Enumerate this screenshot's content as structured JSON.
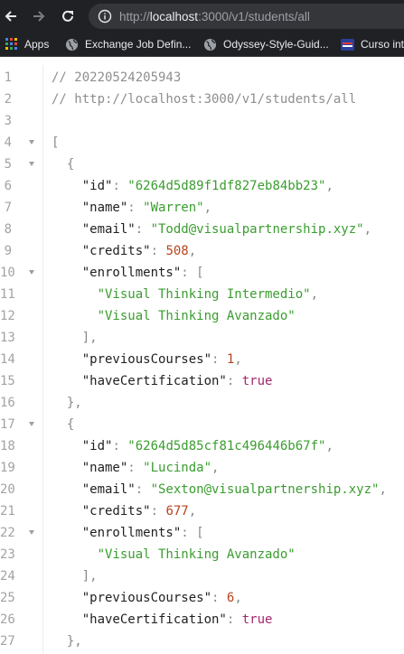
{
  "browser": {
    "url_prefix": "http://",
    "url_host": "localhost",
    "url_rest": ":3000/v1/students/all",
    "bookmarks": [
      {
        "label": "Apps",
        "icon": "apps-grid-icon"
      },
      {
        "label": "Exchange Job Defin...",
        "icon": "globe-icon"
      },
      {
        "label": "Odyssey-Style-Guid...",
        "icon": "globe-icon"
      },
      {
        "label": "Curso int",
        "icon": "flag-icon"
      }
    ]
  },
  "colors": {
    "string": "#3a9d2f",
    "number": "#b8431c",
    "boolean": "#a4286d",
    "comment": "#8e8e8e"
  },
  "json_lines": [
    {
      "n": "1",
      "fold": false,
      "tokens": [
        [
          "c",
          "// 20220524205943"
        ]
      ]
    },
    {
      "n": "2",
      "fold": false,
      "tokens": [
        [
          "c",
          "// http://localhost:3000/v1/students/all"
        ]
      ]
    },
    {
      "n": "3",
      "fold": false,
      "tokens": []
    },
    {
      "n": "4",
      "fold": true,
      "tokens": [
        [
          "p",
          "["
        ]
      ]
    },
    {
      "n": "5",
      "fold": true,
      "tokens": [
        [
          "p",
          "  {"
        ]
      ]
    },
    {
      "n": "6",
      "fold": false,
      "tokens": [
        [
          "k",
          "    \"id\""
        ],
        [
          "p",
          ": "
        ],
        [
          "s",
          "\"6264d5d89f1df827eb84bb23\""
        ],
        [
          "p",
          ","
        ]
      ]
    },
    {
      "n": "7",
      "fold": false,
      "tokens": [
        [
          "k",
          "    \"name\""
        ],
        [
          "p",
          ": "
        ],
        [
          "s",
          "\"Warren\""
        ],
        [
          "p",
          ","
        ]
      ]
    },
    {
      "n": "8",
      "fold": false,
      "tokens": [
        [
          "k",
          "    \"email\""
        ],
        [
          "p",
          ": "
        ],
        [
          "s",
          "\"Todd@visualpartnership.xyz\""
        ],
        [
          "p",
          ","
        ]
      ]
    },
    {
      "n": "9",
      "fold": false,
      "tokens": [
        [
          "k",
          "    \"credits\""
        ],
        [
          "p",
          ": "
        ],
        [
          "n",
          "508"
        ],
        [
          "p",
          ","
        ]
      ]
    },
    {
      "n": "10",
      "fold": true,
      "tokens": [
        [
          "k",
          "    \"enrollments\""
        ],
        [
          "p",
          ": ["
        ]
      ]
    },
    {
      "n": "11",
      "fold": false,
      "tokens": [
        [
          "s",
          "      \"Visual Thinking Intermedio\""
        ],
        [
          "p",
          ","
        ]
      ]
    },
    {
      "n": "12",
      "fold": false,
      "tokens": [
        [
          "s",
          "      \"Visual Thinking Avanzado\""
        ]
      ]
    },
    {
      "n": "13",
      "fold": false,
      "tokens": [
        [
          "p",
          "    ],"
        ]
      ]
    },
    {
      "n": "14",
      "fold": false,
      "tokens": [
        [
          "k",
          "    \"previousCourses\""
        ],
        [
          "p",
          ": "
        ],
        [
          "n",
          "1"
        ],
        [
          "p",
          ","
        ]
      ]
    },
    {
      "n": "15",
      "fold": false,
      "tokens": [
        [
          "k",
          "    \"haveCertification\""
        ],
        [
          "p",
          ": "
        ],
        [
          "b",
          "true"
        ]
      ]
    },
    {
      "n": "16",
      "fold": false,
      "tokens": [
        [
          "p",
          "  },"
        ]
      ]
    },
    {
      "n": "17",
      "fold": true,
      "tokens": [
        [
          "p",
          "  {"
        ]
      ]
    },
    {
      "n": "18",
      "fold": false,
      "tokens": [
        [
          "k",
          "    \"id\""
        ],
        [
          "p",
          ": "
        ],
        [
          "s",
          "\"6264d5d85cf81c496446b67f\""
        ],
        [
          "p",
          ","
        ]
      ]
    },
    {
      "n": "19",
      "fold": false,
      "tokens": [
        [
          "k",
          "    \"name\""
        ],
        [
          "p",
          ": "
        ],
        [
          "s",
          "\"Lucinda\""
        ],
        [
          "p",
          ","
        ]
      ]
    },
    {
      "n": "20",
      "fold": false,
      "tokens": [
        [
          "k",
          "    \"email\""
        ],
        [
          "p",
          ": "
        ],
        [
          "s",
          "\"Sexton@visualpartnership.xyz\""
        ],
        [
          "p",
          ","
        ]
      ]
    },
    {
      "n": "21",
      "fold": false,
      "tokens": [
        [
          "k",
          "    \"credits\""
        ],
        [
          "p",
          ": "
        ],
        [
          "n",
          "677"
        ],
        [
          "p",
          ","
        ]
      ]
    },
    {
      "n": "22",
      "fold": true,
      "tokens": [
        [
          "k",
          "    \"enrollments\""
        ],
        [
          "p",
          ": ["
        ]
      ]
    },
    {
      "n": "23",
      "fold": false,
      "tokens": [
        [
          "s",
          "      \"Visual Thinking Avanzado\""
        ]
      ]
    },
    {
      "n": "24",
      "fold": false,
      "tokens": [
        [
          "p",
          "    ],"
        ]
      ]
    },
    {
      "n": "25",
      "fold": false,
      "tokens": [
        [
          "k",
          "    \"previousCourses\""
        ],
        [
          "p",
          ": "
        ],
        [
          "n",
          "6"
        ],
        [
          "p",
          ","
        ]
      ]
    },
    {
      "n": "26",
      "fold": false,
      "tokens": [
        [
          "k",
          "    \"haveCertification\""
        ],
        [
          "p",
          ": "
        ],
        [
          "b",
          "true"
        ]
      ]
    },
    {
      "n": "27",
      "fold": false,
      "tokens": [
        [
          "p",
          "  },"
        ]
      ]
    }
  ]
}
